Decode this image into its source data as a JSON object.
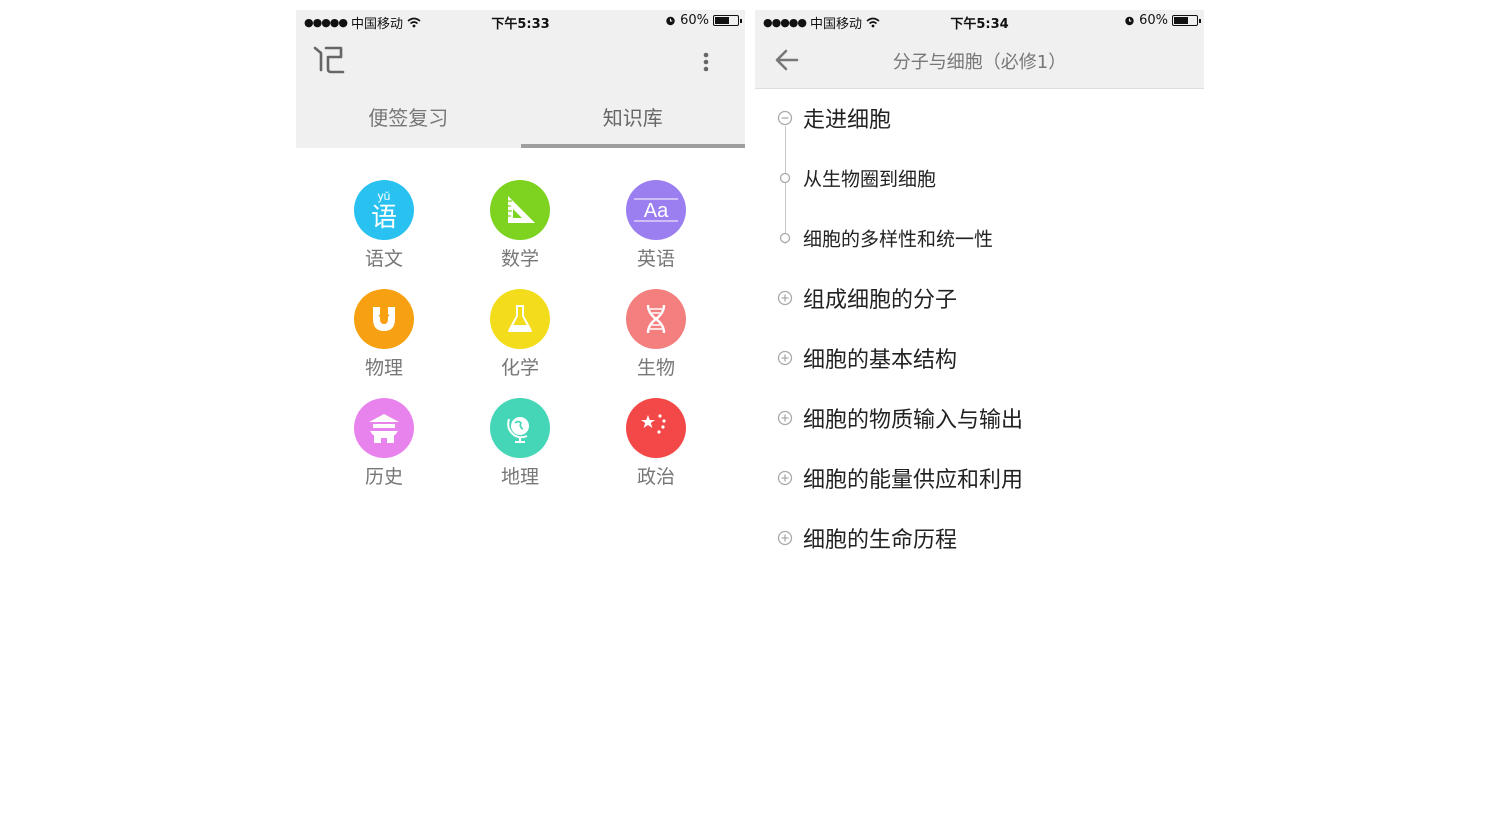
{
  "left_screen": {
    "status": {
      "carrier": "中国移动",
      "time": "下午5:33",
      "battery": "60%"
    },
    "tabs": [
      {
        "label": "便签复习",
        "active": false
      },
      {
        "label": "知识库",
        "active": true
      }
    ],
    "subjects": [
      {
        "label": "语文",
        "icon": "chinese-icon",
        "color": "#29c2f0",
        "glyph": "语",
        "pinyin": "yǔ"
      },
      {
        "label": "数学",
        "icon": "ruler-triangle-icon",
        "color": "#7ed321"
      },
      {
        "label": "英语",
        "icon": "aa-icon",
        "color": "#9b7ff0",
        "glyph": "Aa"
      },
      {
        "label": "物理",
        "icon": "magnet-icon",
        "color": "#f7a011"
      },
      {
        "label": "化学",
        "icon": "flask-icon",
        "color": "#f2dc1b"
      },
      {
        "label": "生物",
        "icon": "dna-icon",
        "color": "#f47f7f"
      },
      {
        "label": "历史",
        "icon": "temple-icon",
        "color": "#e882ec"
      },
      {
        "label": "地理",
        "icon": "globe-icon",
        "color": "#45d6b8"
      },
      {
        "label": "政治",
        "icon": "flag-stars-icon",
        "color": "#f24848"
      }
    ]
  },
  "right_screen": {
    "status": {
      "carrier": "中国移动",
      "time": "下午5:34",
      "battery": "60%"
    },
    "title": "分子与细胞（必修1）",
    "nodes": [
      {
        "label": "走进细胞",
        "level": 1,
        "state": "expanded"
      },
      {
        "label": "从生物圈到细胞",
        "level": 2,
        "state": "leaf"
      },
      {
        "label": "细胞的多样性和统一性",
        "level": 2,
        "state": "leaf"
      },
      {
        "label": "组成细胞的分子",
        "level": 1,
        "state": "collapsed"
      },
      {
        "label": "细胞的基本结构",
        "level": 1,
        "state": "collapsed"
      },
      {
        "label": "细胞的物质输入与输出",
        "level": 1,
        "state": "collapsed"
      },
      {
        "label": "细胞的能量供应和利用",
        "level": 1,
        "state": "collapsed"
      },
      {
        "label": "细胞的生命历程",
        "level": 1,
        "state": "collapsed"
      }
    ]
  }
}
